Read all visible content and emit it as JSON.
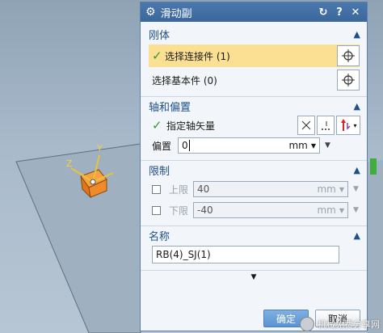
{
  "dialog": {
    "title": "滑动副",
    "icons": [
      "gear-icon",
      "reset-icon",
      "help-icon",
      "close-icon"
    ]
  },
  "rigid_body": {
    "header": "刚体",
    "select_connected": "选择连接件 (1)",
    "select_base": "选择基本件 (0)"
  },
  "axis": {
    "header": "轴和偏置",
    "specify_vector": "指定轴矢量",
    "offset_label": "偏置",
    "offset_value": "0",
    "offset_unit": "mm"
  },
  "limits": {
    "header": "限制",
    "upper_label": "上限",
    "upper_value": "40",
    "upper_unit": "mm",
    "lower_label": "下限",
    "lower_value": "-40",
    "lower_unit": "mm"
  },
  "name": {
    "header": "名称",
    "value": "RB(4)_SJ(1)"
  },
  "buttons": {
    "ok": "确定",
    "cancel": "取消"
  },
  "watermark": {
    "text": "机械免费分享网"
  },
  "viewport": {
    "triad_labels": [
      "Y",
      "Z"
    ]
  },
  "colors": {
    "title_bar": "#4a78ad",
    "selected_row": "#fbdf93",
    "check": "#2e9d2e",
    "primary_button": "#6aa0d8"
  }
}
